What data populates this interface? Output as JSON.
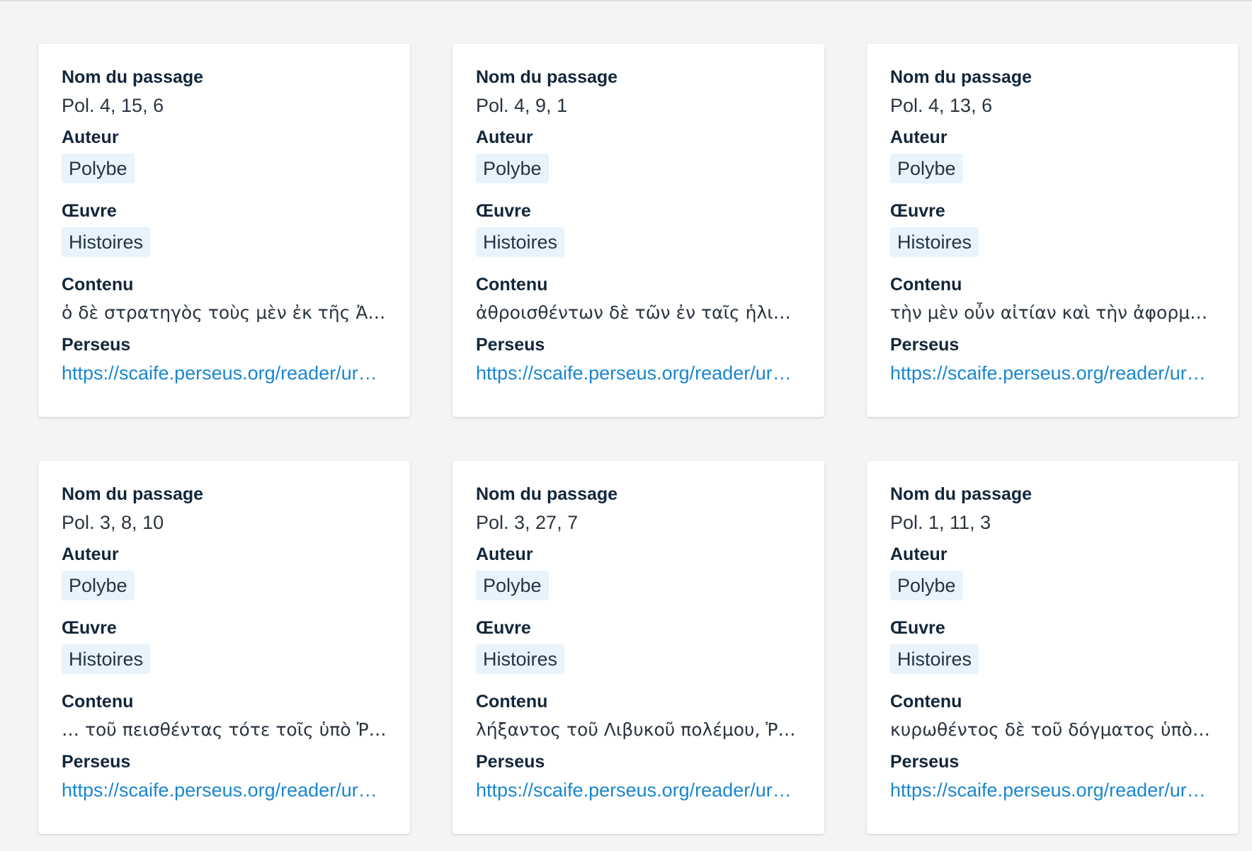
{
  "labels": {
    "passage": "Nom du passage",
    "author": "Auteur",
    "work": "Œuvre",
    "content": "Contenu",
    "perseus": "Perseus"
  },
  "cards": [
    {
      "passage": "Pol. 4, 15, 6",
      "author": "Polybe",
      "work": "Histoires",
      "content": "ὁ δὲ στρατηγὸς τοὺς μὲν ἐκ τῆς Ἀχαΐ…",
      "url": "https://scaife.perseus.org/reader/ur…"
    },
    {
      "passage": "Pol. 4, 9, 1",
      "author": "Polybe",
      "work": "Histoires",
      "content": "ἀθροισθέντων δὲ τῶν ἐν ταῖς ἡλικίαι…",
      "url": "https://scaife.perseus.org/reader/ur…"
    },
    {
      "passage": "Pol. 4, 13, 6",
      "author": "Polybe",
      "work": "Histoires",
      "content": "τὴν μὲν οὖν αἰτίαν καὶ τὴν ἀφορμὴν …",
      "url": "https://scaife.perseus.org/reader/ur…"
    },
    {
      "passage": "Pol. 3, 8, 10",
      "author": "Polybe",
      "work": "Histoires",
      "content": "… τοῦ πεισθέντας τότε τοῖς ὑπὸ Ῥωμ…",
      "url": "https://scaife.perseus.org/reader/ur…"
    },
    {
      "passage": "Pol. 3, 27, 7",
      "author": "Polybe",
      "work": "Histoires",
      "content": "λήξαντος τοῦ Λιβυκοῦ πολέμου, Ῥω…",
      "url": "https://scaife.perseus.org/reader/ur…"
    },
    {
      "passage": "Pol. 1, 11, 3",
      "author": "Polybe",
      "work": "Histoires",
      "content": "κυρωθέντος δὲ τοῦ δόγματος ὑπὸ τ…",
      "url": "https://scaife.perseus.org/reader/ur…"
    }
  ]
}
